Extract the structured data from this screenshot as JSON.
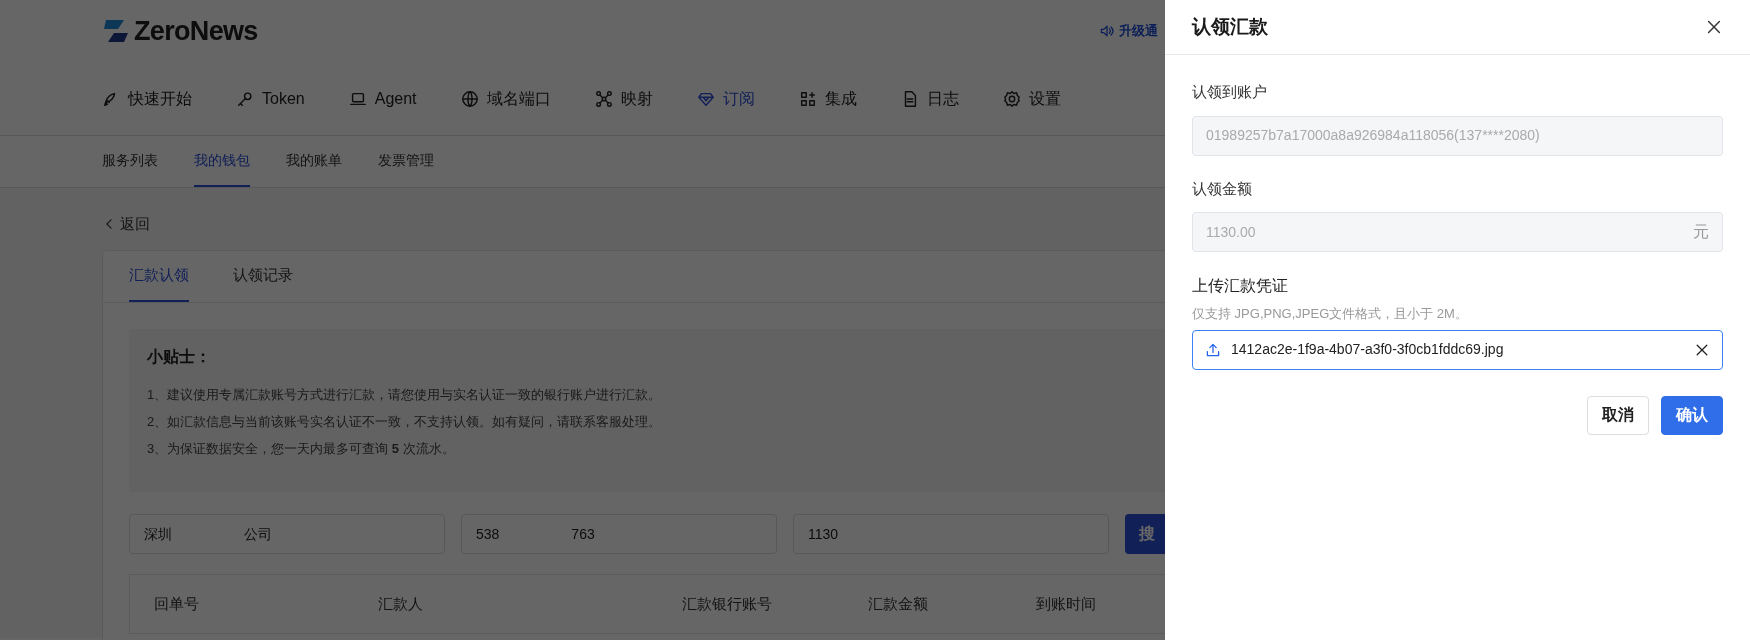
{
  "header": {
    "logo": "ZeroNews",
    "notice": "升级通"
  },
  "nav": [
    {
      "label": "快速开始",
      "selected": false
    },
    {
      "label": "Token",
      "selected": false
    },
    {
      "label": "Agent",
      "selected": false
    },
    {
      "label": "域名端口",
      "selected": false
    },
    {
      "label": "映射",
      "selected": false
    },
    {
      "label": "订阅",
      "selected": true
    },
    {
      "label": "集成",
      "selected": false
    },
    {
      "label": "日志",
      "selected": false
    },
    {
      "label": "设置",
      "selected": false
    }
  ],
  "subnav": [
    {
      "label": "服务列表",
      "selected": false
    },
    {
      "label": "我的钱包",
      "selected": true
    },
    {
      "label": "我的账单",
      "selected": false
    },
    {
      "label": "发票管理",
      "selected": false
    }
  ],
  "back": "返回",
  "card_tabs": [
    {
      "label": "汇款认领",
      "selected": true
    },
    {
      "label": "认领记录",
      "selected": false
    }
  ],
  "tips": {
    "title": "小贴士：",
    "lines": [
      "1、建议使用专属汇款账号方式进行汇款，请您使用与实名认证一致的银行账户进行汇款。",
      "2、如汇款信息与当前该账号实名认证不一致，不支持认领。如有疑问，请联系客服处理。",
      "3、为保证数据安全，您一天内最多可查询 **5** 次流水。"
    ]
  },
  "search": {
    "fields": [
      {
        "parts": [
          "深圳",
          "公司"
        ]
      },
      {
        "parts": [
          "538",
          "763"
        ]
      },
      {
        "parts": [
          "1130"
        ]
      }
    ],
    "button": "搜"
  },
  "table": {
    "columns": [
      "回单号",
      "汇款人",
      "汇款银行账号",
      "汇款金额",
      "到账时间"
    ]
  },
  "drawer": {
    "title": "认领汇款",
    "fields": [
      {
        "label": "认领到账户",
        "value": "01989257b7a17000a8a926984a118056(137****2080)"
      },
      {
        "label": "认领金额",
        "value": "1130.00",
        "suffix": "元"
      }
    ],
    "upload": {
      "label": "上传汇款凭证",
      "hint": "仅支持 JPG,PNG,JPEG文件格式，且小于 2M。",
      "file": "1412ac2e-1f9a-4b07-a3f0-3f0cb1fddc69.jpg"
    },
    "buttons": [
      {
        "label": "取消",
        "kind": "secondary"
      },
      {
        "label": "确认",
        "kind": "primary"
      }
    ]
  }
}
